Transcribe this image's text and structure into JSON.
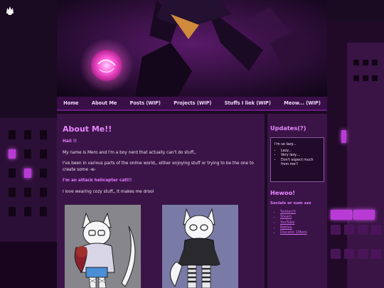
{
  "nav": {
    "items": [
      "Home",
      "About Me",
      "Posts (WIP)",
      "Projects (WIP)",
      "Stuffs I liek (WIP)",
      "Meow... (WIP)"
    ]
  },
  "main": {
    "title": "About Me!!",
    "greeting": "Haii !!",
    "p1": "My name is Mero and I'm a boy nerd that actually can't do stuff,,",
    "p2": "I've been in various parts of the online world,, either enjoying stuff or trying to be the one to create some -w-",
    "p3": "I'm an attack helicopter catl!!",
    "p4": "I love wearing cozy stuff,, it makes me drool"
  },
  "sidebar": {
    "updates_title": "Updates(?)",
    "updates_intro": "I'm so lazy...",
    "updates_items": [
      "Lazy...",
      "Very lazy....",
      "Don't expect much from me!!"
    ],
    "hewoo_title": "Hewoo!",
    "socials_title": "Socials or sum zzz",
    "links": [
      "Twitter/X",
      "Steam",
      "YouTube",
      "Roblox",
      "Discord: 1Mero"
    ]
  },
  "colors": {
    "accent": "#e887ff",
    "panel": "#3b1447",
    "nav": "#3a0f48",
    "glow": "#d25cf0"
  }
}
